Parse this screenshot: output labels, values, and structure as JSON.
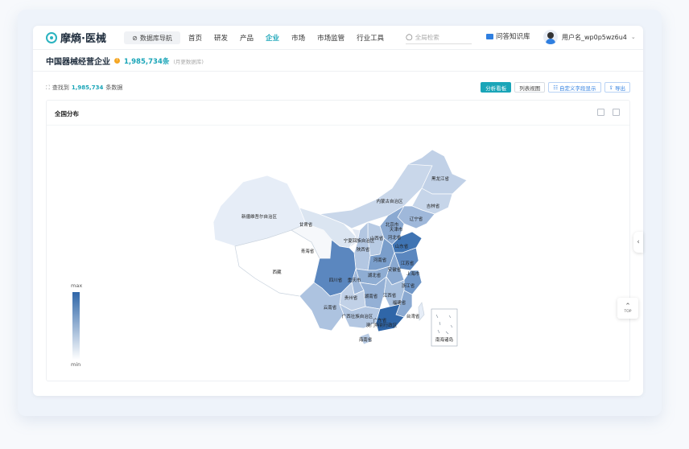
{
  "nav": {
    "logo": "摩熵·医械",
    "db_nav": "数据库导航",
    "menu": [
      "首页",
      "研发",
      "产品",
      "企业",
      "市场",
      "市场监管",
      "行业工具"
    ],
    "active_index": 3,
    "search_placeholder": "全局检索",
    "knowledge": "问答知识库",
    "username": "用户名_wp0p5wz6u4"
  },
  "header": {
    "title": "中国器械经营企业",
    "count": "1,985,734条",
    "note": "(月更数据库)"
  },
  "toolbar": {
    "found_prefix": "查找到",
    "found_count": "1,985,734",
    "found_suffix": "条数据",
    "btn_analysis": "分析看板",
    "btn_list": "列表视图",
    "btn_custom": "自定义字段显示",
    "btn_export": "导出"
  },
  "panel": {
    "title": "全国分布"
  },
  "legend": {
    "max": "max",
    "min": "min",
    "colors": [
      "#2f66a8",
      "#ffffff"
    ]
  },
  "map_labels": [
    "黑龙江省",
    "吉林省",
    "内蒙古自治区",
    "辽宁省",
    "北京市",
    "天津市",
    "河北省",
    "山西省",
    "宁夏回族自治区",
    "甘肃省",
    "新疆维吾尔自治区",
    "青海省",
    "陕西省",
    "山东省",
    "河南省",
    "江苏省",
    "安徽省",
    "上海市",
    "西藏",
    "四川省",
    "重庆市",
    "湖北省",
    "浙江省",
    "贵州省",
    "湖南省",
    "江西省",
    "云南省",
    "福建省",
    "广西壮族自治区",
    "广东省",
    "台湾省",
    "澳门特别行政区",
    "海南省",
    "南海诸岛"
  ],
  "top_button": "TOP"
}
